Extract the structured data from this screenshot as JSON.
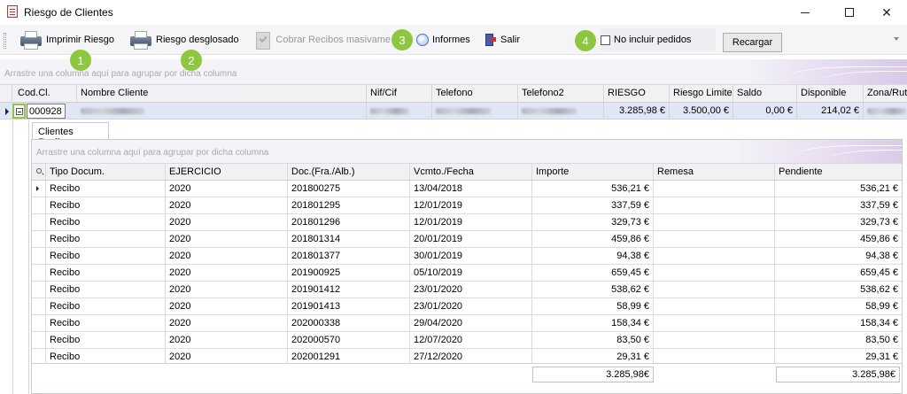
{
  "window": {
    "title": "Riesgo de Clientes",
    "controls": {
      "minimize": "minimize-icon",
      "maximize": "maximize-icon",
      "close": "✕"
    }
  },
  "toolbar": {
    "imprimir_riesgo": "Imprimir Riesgo",
    "riesgo_desglosado": "Riesgo desglosado",
    "cobrar_recibos": "Cobrar Recibos masivame",
    "informes": "Informes",
    "salir": "Salir",
    "no_incluir_pedidos": "No incluir pedidos",
    "no_incluir_pedidos_checked": false,
    "recargar": "Recargar"
  },
  "badges": [
    "1",
    "2",
    "3",
    "4"
  ],
  "accent_color": "#8dc63f",
  "group_panel_hint": "Arrastre una columna aquí para agrupar por dicha columna",
  "master": {
    "columns": [
      "Cod.Cl.",
      "Nombre Cliente",
      "Nif/Cif",
      "Telefono",
      "Telefono2",
      "RIESGO",
      "Riesgo Limite",
      "Saldo",
      "Disponible",
      "Zona/Ruta"
    ],
    "row": {
      "cod": "000928",
      "riesgo": "3.285,98 €",
      "riesgo_limite": "3.500,00 €",
      "saldo": "0,00 €",
      "disponible": "214,02 €"
    }
  },
  "detail": {
    "tab": "Clientes Recibos",
    "group_hint": "Arrastre una columna aquí para agrupar por dicha columna",
    "columns": [
      "Tipo Docum.",
      "EJERCICIO",
      "Doc.(Fra./Alb.)",
      "Vcmto./Fecha",
      "Importe",
      "Remesa",
      "Pendiente"
    ],
    "rows": [
      [
        "Recibo",
        "2020",
        "201800275",
        "13/04/2018",
        "536,21 €",
        "",
        "536,21 €"
      ],
      [
        "Recibo",
        "2020",
        "201801295",
        "12/01/2019",
        "337,59 €",
        "",
        "337,59 €"
      ],
      [
        "Recibo",
        "2020",
        "201801296",
        "12/01/2019",
        "329,73 €",
        "",
        "329,73 €"
      ],
      [
        "Recibo",
        "2020",
        "201801314",
        "20/01/2019",
        "459,86 €",
        "",
        "459,86 €"
      ],
      [
        "Recibo",
        "2020",
        "201801377",
        "30/01/2019",
        "94,38 €",
        "",
        "94,38 €"
      ],
      [
        "Recibo",
        "2020",
        "201900925",
        "05/10/2019",
        "659,45 €",
        "",
        "659,45 €"
      ],
      [
        "Recibo",
        "2020",
        "201901412",
        "23/01/2020",
        "538,62 €",
        "",
        "538,62 €"
      ],
      [
        "Recibo",
        "2020",
        "201901413",
        "23/01/2020",
        "58,99 €",
        "",
        "58,99 €"
      ],
      [
        "Recibo",
        "2020",
        "202000338",
        "29/04/2020",
        "158,34 €",
        "",
        "158,34 €"
      ],
      [
        "Recibo",
        "2020",
        "202000570",
        "12/07/2020",
        "83,50 €",
        "",
        "83,50 €"
      ],
      [
        "Recibo",
        "2020",
        "202001291",
        "27/12/2020",
        "29,31 €",
        "",
        "29,31 €"
      ]
    ],
    "total_importe": "3.285,98€",
    "total_pendiente": "3.285,98€"
  }
}
